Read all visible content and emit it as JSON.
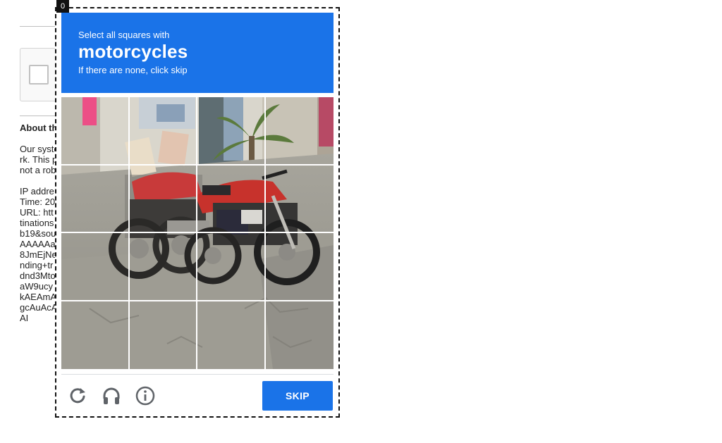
{
  "page": {
    "heading": "About th",
    "paragraph_lines": [
      "Our syste",
      "rk. This p",
      "not a rob"
    ],
    "details_lines": [
      "IP addre",
      "Time: 20",
      "URL: htt",
      "tinations",
      "b19&sou",
      "AAAAAa",
      "8JmEjNe",
      "nding+tr",
      "dnd3Mto",
      "aW9ucy",
      "kAEAmA",
      "gcAuAcA",
      "AI"
    ]
  },
  "counter": "0",
  "challenge": {
    "instruction": "Select all squares with",
    "target": "motorcycles",
    "hint": "If there are none, click skip",
    "grid": {
      "rows": 4,
      "cols": 4
    },
    "icons": {
      "reload": "reload-icon",
      "audio": "headphones-icon",
      "info": "info-icon"
    },
    "skip_label": "SKIP"
  },
  "colors": {
    "accent": "#1a73e8",
    "border": "#111111"
  }
}
